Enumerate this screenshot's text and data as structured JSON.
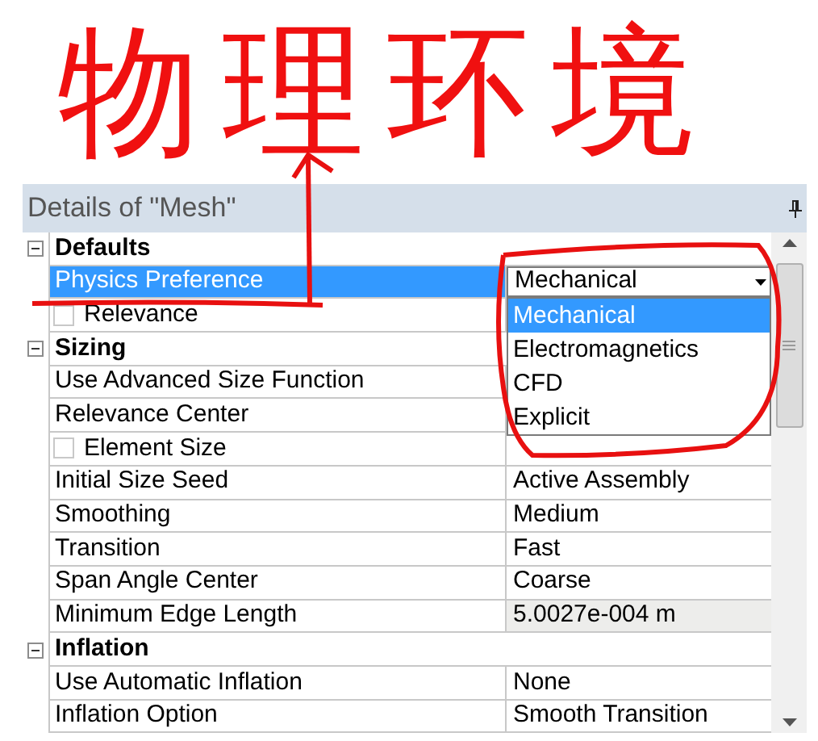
{
  "annotation": {
    "text": "物理环境"
  },
  "panel": {
    "title": "Details of \"Mesh\""
  },
  "groups": [
    {
      "label": "Defaults",
      "expanded": true,
      "rows": [
        {
          "kind": "dropdown",
          "label": "Physics Preference",
          "value": "Mechanical",
          "selected": true,
          "options": [
            {
              "label": "Mechanical",
              "selected": true
            },
            {
              "label": "Electromagnetics",
              "selected": false
            },
            {
              "label": "CFD",
              "selected": false
            },
            {
              "label": "Explicit",
              "selected": false
            }
          ]
        },
        {
          "kind": "checkbox",
          "label": "Relevance",
          "checked": false,
          "selected": false
        }
      ]
    },
    {
      "label": "Sizing",
      "expanded": true,
      "rows": [
        {
          "kind": "plain",
          "label": "Use Advanced Size Function",
          "selected": false
        },
        {
          "kind": "plain",
          "label": "Relevance Center",
          "selected": false
        },
        {
          "kind": "checkbox",
          "label": "Element Size",
          "checked": false,
          "selected": false
        },
        {
          "kind": "plain",
          "label": "Initial Size Seed",
          "value": "Active Assembly",
          "selected": false
        },
        {
          "kind": "plain",
          "label": "Smoothing",
          "value": "Medium",
          "selected": false
        },
        {
          "kind": "plain",
          "label": "Transition",
          "value": "Fast",
          "selected": false
        },
        {
          "kind": "plain",
          "label": "Span Angle Center",
          "value": "Coarse",
          "selected": false
        },
        {
          "kind": "plain",
          "label": "Minimum Edge Length",
          "value": "5.0027e-004 m",
          "readonly": true,
          "selected": false
        }
      ]
    },
    {
      "label": "Inflation",
      "expanded": true,
      "rows": [
        {
          "kind": "plain",
          "label": "Use Automatic Inflation",
          "value": "None",
          "selected": false
        },
        {
          "kind": "plain",
          "label": "Inflation Option",
          "value": "Smooth Transition",
          "selected": false
        }
      ]
    }
  ]
}
